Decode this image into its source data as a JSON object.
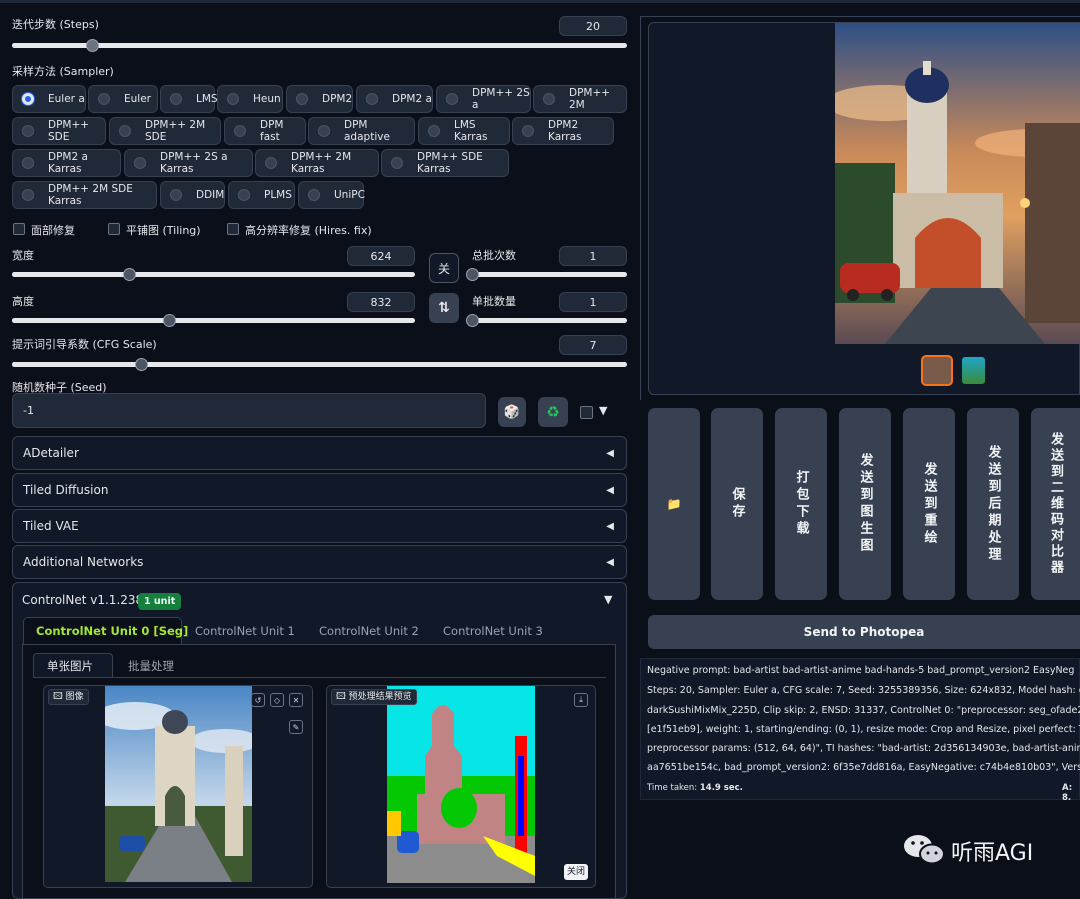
{
  "steps": {
    "label": "迭代步数 (Steps)",
    "value": "20",
    "fraction": 0.13
  },
  "sampler": {
    "label": "采样方法 (Sampler)",
    "selected": "Euler a",
    "options": [
      "Euler a",
      "Euler",
      "LMS",
      "Heun",
      "DPM2",
      "DPM2 a",
      "DPM++ 2S a",
      "DPM++ 2M",
      "DPM++ SDE",
      "DPM++ 2M SDE",
      "DPM fast",
      "DPM adaptive",
      "LMS Karras",
      "DPM2 Karras",
      "DPM2 a Karras",
      "DPM++ 2S a Karras",
      "DPM++ 2M Karras",
      "DPM++ SDE Karras",
      "DPM++ 2M SDE Karras",
      "DDIM",
      "PLMS",
      "UniPC"
    ]
  },
  "options": {
    "face": "面部修复",
    "tiling": "平铺图 (Tiling)",
    "hires": "高分辨率修复 (Hires. fix)"
  },
  "width": {
    "label": "宽度",
    "value": "624",
    "fraction": 0.29
  },
  "height": {
    "label": "高度",
    "value": "832",
    "fraction": 0.39
  },
  "batch_count": {
    "label": "总批次数",
    "value": "1",
    "fraction": 0.0
  },
  "batch_size": {
    "label": "单批数量",
    "value": "1",
    "fraction": 0.0
  },
  "swap_icon": "关",
  "swap_icon2": "⇅",
  "cfg": {
    "label": "提示词引导系数 (CFG Scale)",
    "value": "7",
    "fraction": 0.21
  },
  "seed": {
    "label": "随机数种子 (Seed)",
    "value": "-1",
    "dice": "🎲",
    "recycle": "♻"
  },
  "extensions": [
    "ADetailer",
    "Tiled Diffusion",
    "Tiled VAE",
    "Additional Networks"
  ],
  "controlnet": {
    "title": "ControlNet v1.1.238",
    "badge": "1 unit",
    "tabs": [
      "ControlNet Unit 0 [Seg]",
      "ControlNet Unit 1",
      "ControlNet Unit 2",
      "ControlNet Unit 3"
    ],
    "subtabs": [
      "单张图片",
      "批量处理"
    ],
    "image_label": "图像",
    "preview_label": "预处理结果预览",
    "close": "关闭"
  },
  "actions": {
    "folder": "📁",
    "save": "保存",
    "zip": "打包下载",
    "to_img2img": "发送到图生图",
    "to_inpaint": "发送到重绘",
    "to_extras": "发送到后期处理",
    "to_qr": "发送到二维码对比器",
    "photopea": "Send to Photopea"
  },
  "info_lines": [
    "Negative prompt: bad-artist bad-artist-anime bad-hands-5 bad_prompt_version2 EasyNeg",
    "Steps: 20, Sampler: Euler a, CFG scale: 7, Seed: 3255389356, Size: 624x832, Model hash: cca",
    "darkSushiMixMix_225D, Clip skip: 2, ENSD: 31337, ControlNet 0: \"preprocessor: seg_ofade2",
    "[e1f51eb9], weight: 1, starting/ending: (0, 1), resize mode: Crop and Resize, pixel perfect: Tr",
    "preprocessor params: (512, 64, 64)\", TI hashes: \"bad-artist: 2d356134903e, bad-artist-anime",
    "aa7651be154c, bad_prompt_version2: 6f35e7dd816a, EasyNegative: c74b4e810b03\", Versic"
  ],
  "time_label": "Time taken:",
  "time_value": "14.9 sec.",
  "vram": "A: 8.",
  "watermark": "听雨AGI"
}
